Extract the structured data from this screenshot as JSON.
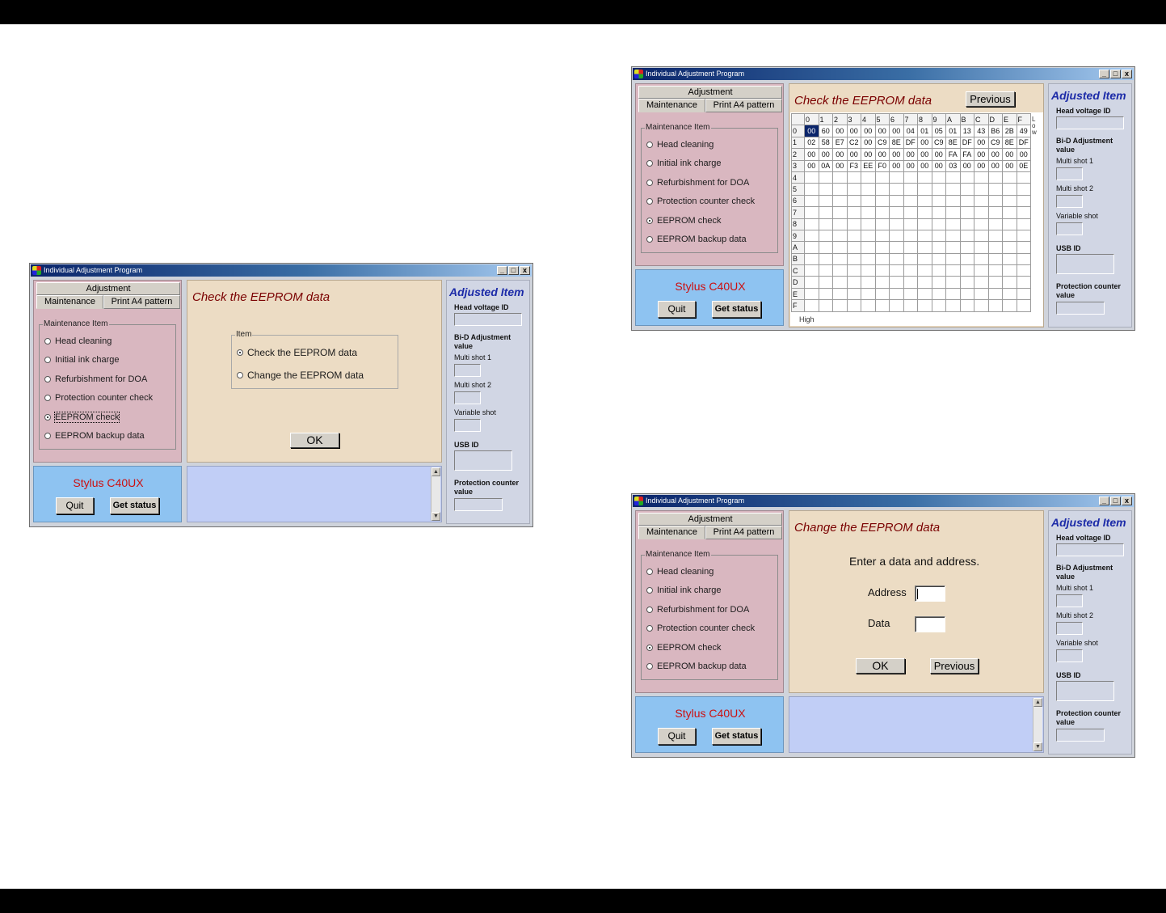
{
  "app": {
    "window_title": "Individual Adjustment Program",
    "window_buttons": {
      "minimize": "_",
      "maximize": "□",
      "close": "x"
    }
  },
  "left": {
    "tab_adjustment": "Adjustment",
    "tab_maintenance": "Maintenance",
    "tab_print": "Print A4 pattern",
    "group_label": "Maintenance Item",
    "items": [
      "Head cleaning",
      "Initial ink charge",
      "Refurbishment for DOA",
      "Protection counter check",
      "EEPROM check",
      "EEPROM backup data"
    ],
    "selected_item": "EEPROM check",
    "model": "Stylus C40UX",
    "quit": "Quit",
    "get_status": "Get status"
  },
  "right": {
    "title": "Adjusted Item",
    "head_voltage": "Head voltage ID",
    "bid": "Bi-D Adjustment value",
    "multi1": "Multi shot 1",
    "multi2": "Multi shot 2",
    "variable": "Variable shot",
    "usb": "USB ID",
    "protection": "Protection counter value"
  },
  "w1": {
    "title": "Check the EEPROM data",
    "group_label": "Item",
    "opt_check": "Check the EEPROM data",
    "opt_change": "Change the EEPROM data",
    "selected": "Check the EEPROM data",
    "ok": "OK"
  },
  "w2": {
    "title": "Check the EEPROM data",
    "previous": "Previous",
    "col_headers": [
      "0",
      "1",
      "2",
      "3",
      "4",
      "5",
      "6",
      "7",
      "8",
      "9",
      "A",
      "B",
      "C",
      "D",
      "E",
      "F"
    ],
    "row_headers": [
      "0",
      "1",
      "2",
      "3",
      "4",
      "5",
      "6",
      "7",
      "8",
      "9",
      "A",
      "B",
      "C",
      "D",
      "E",
      "F"
    ],
    "rows": [
      [
        "00",
        "60",
        "00",
        "00",
        "00",
        "00",
        "00",
        "04",
        "01",
        "05",
        "01",
        "13",
        "43",
        "B6",
        "2B",
        "49"
      ],
      [
        "02",
        "58",
        "E7",
        "C2",
        "00",
        "C9",
        "8E",
        "DF",
        "00",
        "C9",
        "8E",
        "DF",
        "00",
        "C9",
        "8E",
        "DF"
      ],
      [
        "00",
        "00",
        "00",
        "00",
        "00",
        "00",
        "00",
        "00",
        "00",
        "00",
        "FA",
        "FA",
        "00",
        "00",
        "00",
        "00"
      ],
      [
        "00",
        "0A",
        "00",
        "F3",
        "EE",
        "F0",
        "00",
        "00",
        "00",
        "00",
        "03",
        "00",
        "00",
        "00",
        "00",
        "0E"
      ]
    ],
    "low_label": "Low",
    "high_label": "High"
  },
  "w3": {
    "title": "Change the EEPROM data",
    "prompt": "Enter a data and address.",
    "address_label": "Address",
    "data_label": "Data",
    "address_value": "",
    "data_value": "",
    "ok": "OK",
    "previous": "Previous"
  }
}
